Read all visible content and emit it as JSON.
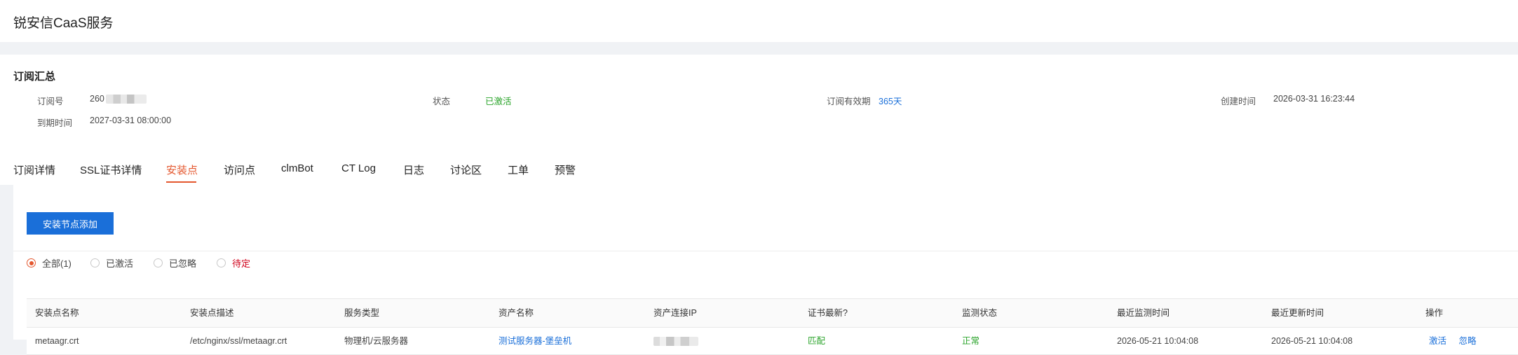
{
  "header": {
    "title": "锐安信CaaS服务"
  },
  "summary": {
    "title": "订阅汇总",
    "fields": {
      "order_no_label": "订阅号",
      "order_no_value": "260",
      "status_label": "状态",
      "status_value": "已激活",
      "validity_label": "订阅有效期",
      "validity_value": "365天",
      "created_label": "创建时间",
      "created_value": "2026-03-31 16:23:44",
      "expire_label": "到期时间",
      "expire_value": "2027-03-31 08:00:00"
    }
  },
  "tabs": [
    {
      "label": "订阅详情"
    },
    {
      "label": "SSL证书详情"
    },
    {
      "label": "安装点"
    },
    {
      "label": "访问点"
    },
    {
      "label": "clmBot"
    },
    {
      "label": "CT Log"
    },
    {
      "label": "日志"
    },
    {
      "label": "讨论区"
    },
    {
      "label": "工单"
    },
    {
      "label": "预警"
    }
  ],
  "active_tab": "安装点",
  "toolbar": {
    "add_label": "安装节点添加"
  },
  "filters": {
    "all": "全部(1)",
    "activated": "已激活",
    "ignored": "已忽略",
    "pending": "待定"
  },
  "table": {
    "columns": [
      "安装点名称",
      "安装点描述",
      "服务类型",
      "资产名称",
      "资产连接IP",
      "证书最新?",
      "监测状态",
      "最近监测时间",
      "最近更新时间",
      "操作"
    ],
    "rows": [
      {
        "name": "metaagr.crt",
        "desc": "/etc/nginx/ssl/metaagr.crt",
        "service_type": "物理机/云服务器",
        "asset_name": "测试服务器-堡垒机",
        "cert_latest": "匹配",
        "monitor_status": "正常",
        "last_monitor": "2026-05-21 10:04:08",
        "last_update": "2026-05-21 10:04:08",
        "actions": [
          "激活",
          "忽略"
        ]
      }
    ]
  },
  "colors": {
    "accent": "#e4572e",
    "primary": "#1a6fd9",
    "success": "#29a329",
    "danger": "#d0021b"
  }
}
